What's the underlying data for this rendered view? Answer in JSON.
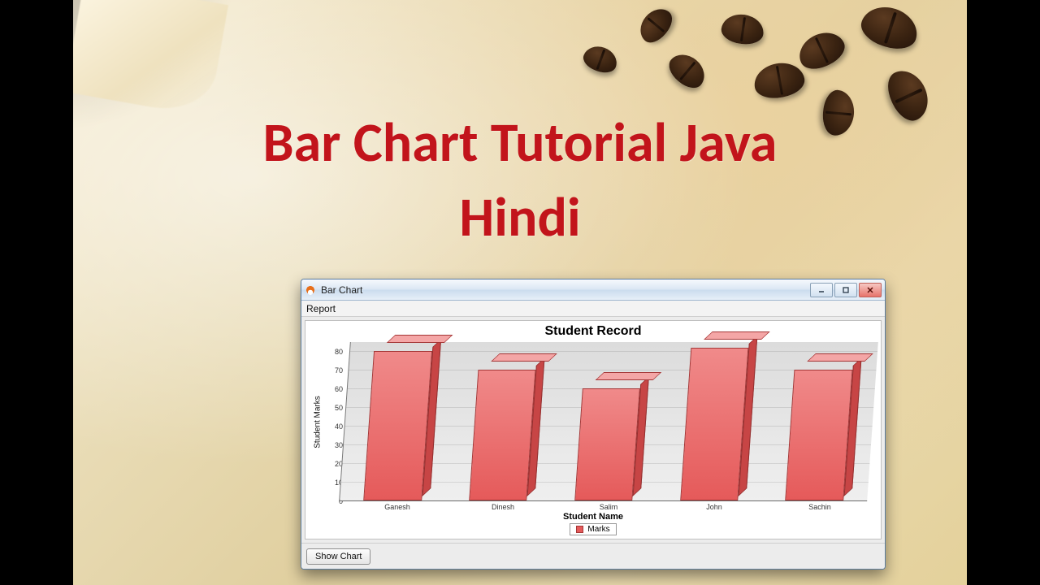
{
  "headline": "Bar Chart Tutorial  Java\nHindi",
  "window": {
    "title": "Bar Chart",
    "menu": "Report",
    "show_button": "Show Chart"
  },
  "chart_data": {
    "type": "bar",
    "title": "Student Record",
    "xlabel": "Student Name",
    "ylabel": "Student Marks",
    "categories": [
      "Ganesh",
      "Dinesh",
      "Salim",
      "John",
      "Sachin"
    ],
    "series": [
      {
        "name": "Marks",
        "values": [
          80,
          70,
          60,
          82,
          70
        ]
      }
    ],
    "yticks": [
      0,
      10,
      20,
      30,
      40,
      50,
      60,
      70,
      80
    ],
    "ylim": [
      0,
      85
    ],
    "legend": "Marks",
    "bar_color": "#e55a5a"
  }
}
